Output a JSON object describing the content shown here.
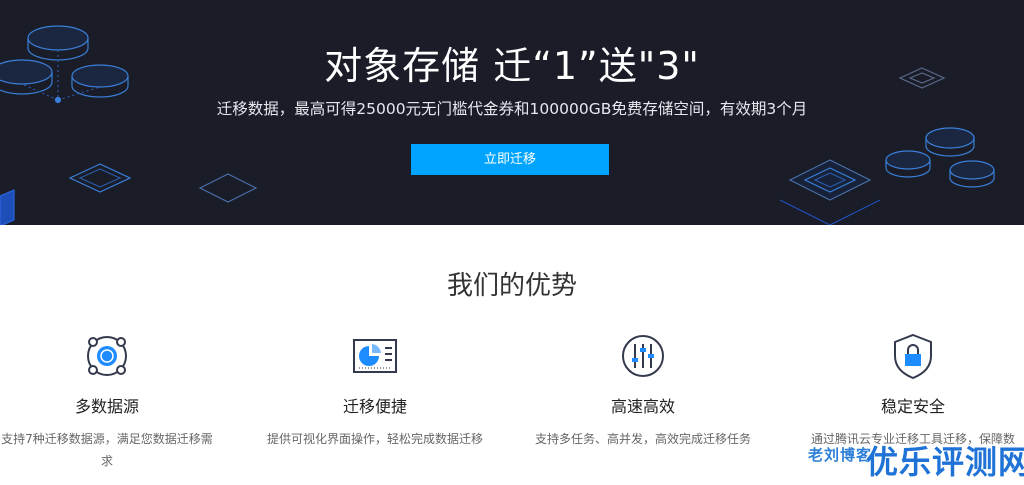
{
  "hero": {
    "title": "对象存储 迁“1”送\"3\"",
    "subtitle": "迁移数据，最高可得25000元无门槛代金券和100000GB免费存储空间，有效期3个月",
    "button_label": "立即迁移"
  },
  "advantages": {
    "title": "我们的优势",
    "items": [
      {
        "name": "多数据源",
        "desc": "支持7种迁移数据源，满足您数据迁移需求",
        "icon": "multi-source-icon"
      },
      {
        "name": "迁移便捷",
        "desc": "提供可视化界面操作，轻松完成数据迁移",
        "icon": "dashboard-icon"
      },
      {
        "name": "高速高效",
        "desc": "支持多任务、高并发，高效完成迁移任务",
        "icon": "sliders-icon"
      },
      {
        "name": "稳定安全",
        "desc": "通过腾讯云专业迁移工具迁移，保障数",
        "icon": "shield-lock-icon"
      }
    ]
  },
  "watermark": {
    "small": "老刘博客",
    "big": "优乐评测网"
  },
  "colors": {
    "hero_bg": "#1a1d28",
    "accent": "#00a4ff",
    "icon_stroke": "#333a4d",
    "icon_accent": "#1e8bff"
  }
}
